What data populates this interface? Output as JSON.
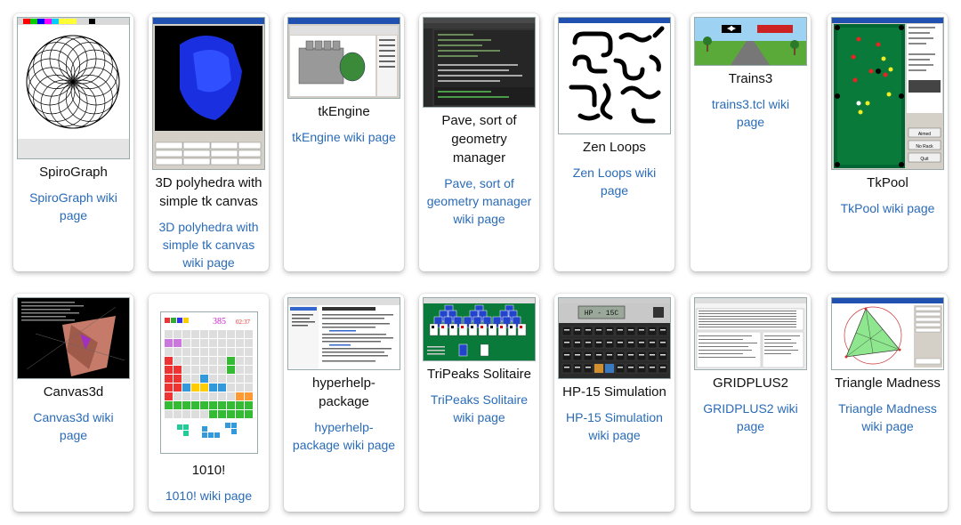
{
  "cards": [
    {
      "title": "SpiroGraph",
      "link": "SpiroGraph wiki page"
    },
    {
      "title": "3D polyhedra with simple tk canvas",
      "link": "3D polyhedra with simple tk canvas wiki page"
    },
    {
      "title": "tkEngine",
      "link": "tkEngine wiki page"
    },
    {
      "title": "Pave, sort of geometry manager",
      "link": "Pave, sort of geometry manager wiki page"
    },
    {
      "title": "Zen Loops",
      "link": "Zen Loops wiki page"
    },
    {
      "title": "Trains3",
      "link": "trains3.tcl wiki page"
    },
    {
      "title": "TkPool",
      "link": "TkPool wiki page"
    },
    {
      "title": "Canvas3d",
      "link": "Canvas3d wiki page"
    },
    {
      "title": "1010!",
      "link": "1010! wiki page"
    },
    {
      "title": "hyperhelp-package",
      "link": "hyperhelp-package wiki page"
    },
    {
      "title": "TriPeaks Solitaire",
      "link": "TriPeaks Solitaire wiki page"
    },
    {
      "title": "HP-15 Simulation",
      "link": "HP-15 Simulation wiki page"
    },
    {
      "title": "GRIDPLUS2",
      "link": "GRIDPLUS2 wiki page"
    },
    {
      "title": "Triangle Madness",
      "link": "Triangle Madness wiki page"
    }
  ],
  "thumbs": {
    "tenten_score": "385",
    "tenten_time": "02:37",
    "hp_display": "HP - 15C",
    "pool_buttons": [
      "Aimed",
      "No Rack",
      "Quit"
    ],
    "pave_pane": "Pave"
  }
}
